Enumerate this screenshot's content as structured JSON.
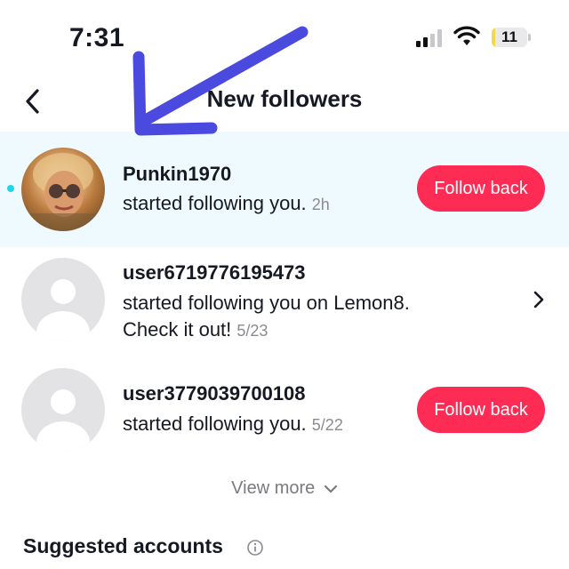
{
  "status_bar": {
    "time": "7:31",
    "battery_level": "11",
    "battery_fraction": 0.11,
    "signal_icon": "cellular-signal-icon",
    "wifi_icon": "wifi-icon"
  },
  "header": {
    "title": "New followers",
    "back_icon": "chevron-left-icon"
  },
  "followers": [
    {
      "username": "Punkin1970",
      "action": "started following you.",
      "time_ago": "2h",
      "button": "Follow back",
      "unread": true,
      "avatar": "photo"
    },
    {
      "username": "user6719776195473",
      "action": "started following you on Lemon8.",
      "action_line2": "Check it out!",
      "time_ago": "5/23",
      "unread": false,
      "avatar": "default"
    },
    {
      "username": "user3779039700108",
      "action": "started following you.",
      "time_ago": "5/22",
      "button": "Follow back",
      "unread": false,
      "avatar": "default"
    }
  ],
  "view_more": "View more",
  "suggested": {
    "title": "Suggested accounts"
  },
  "colors": {
    "accent": "#fe2c55",
    "unread_bg": "#eefaff",
    "unread_dot": "#20d5ec",
    "annotation_arrow": "#4a4adf"
  }
}
